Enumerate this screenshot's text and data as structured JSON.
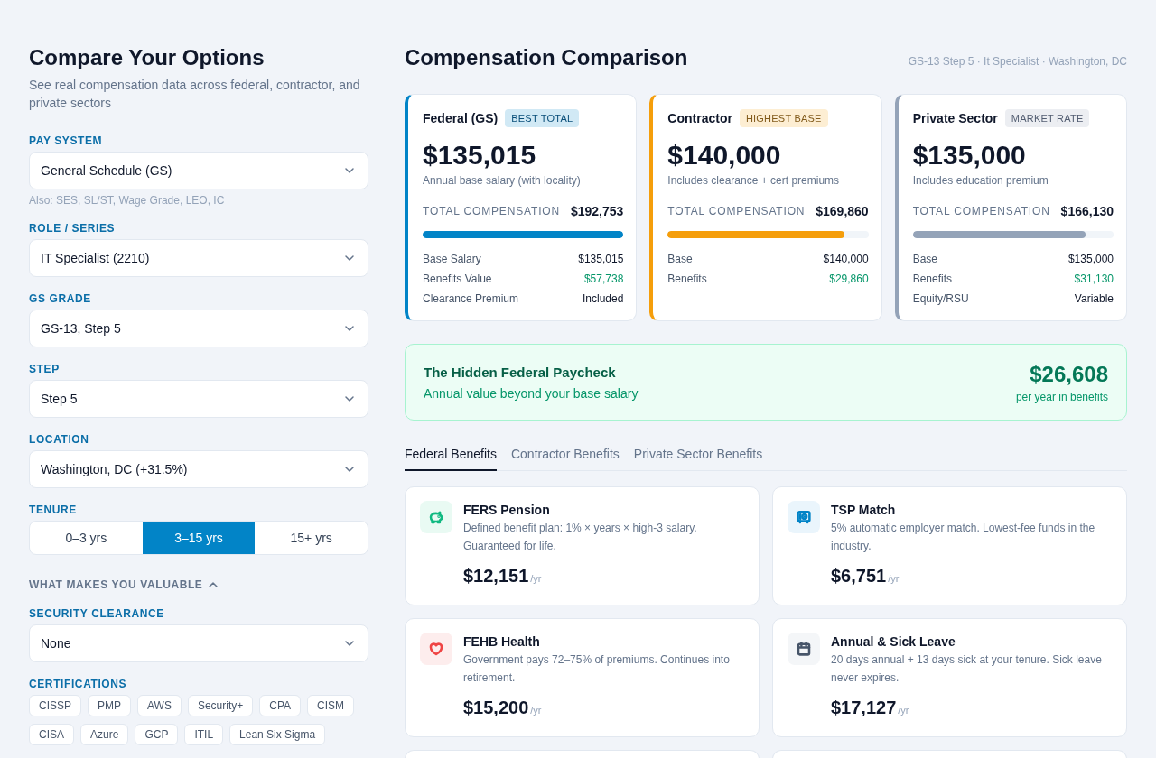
{
  "sidebar": {
    "title": "Compare Your Options",
    "subtitle": "See real compensation data across federal, contractor, and private sectors",
    "fields": [
      {
        "label": "PAY SYSTEM",
        "value": "General Schedule (GS)",
        "hint": "Also: SES, SL/ST, Wage Grade, LEO, IC"
      },
      {
        "label": "ROLE / SERIES",
        "value": "IT Specialist (2210)"
      },
      {
        "label": "GS GRADE",
        "value": "GS-13, Step 5"
      },
      {
        "label": "STEP",
        "value": "Step 5"
      },
      {
        "label": "LOCATION",
        "value": "Washington, DC (+31.5%)"
      }
    ],
    "tenure": {
      "label": "TENURE",
      "options": [
        {
          "label": "0–3 yrs",
          "selected": false
        },
        {
          "label": "3–15 yrs",
          "selected": true
        },
        {
          "label": "15+ yrs",
          "selected": false
        }
      ]
    },
    "valuable": {
      "label": "WHAT MAKES YOU VALUABLE",
      "expanded": true,
      "clearance": {
        "label": "SECURITY CLEARANCE",
        "value": "None"
      },
      "certifications": {
        "label": "CERTIFICATIONS",
        "items": [
          {
            "label": "CISSP",
            "selected": false
          },
          {
            "label": "PMP",
            "selected": false
          },
          {
            "label": "AWS",
            "selected": false
          },
          {
            "label": "Security+",
            "selected": false
          },
          {
            "label": "CPA",
            "selected": false
          },
          {
            "label": "CISM",
            "selected": false
          },
          {
            "label": "CISA",
            "selected": false
          },
          {
            "label": "Azure",
            "selected": false
          },
          {
            "label": "GCP",
            "selected": false
          },
          {
            "label": "ITIL",
            "selected": false
          },
          {
            "label": "Lean Six Sigma",
            "selected": false
          }
        ]
      }
    }
  },
  "main": {
    "title": "Compensation Comparison",
    "context": "GS-13 Step 5 · It Specialist · Washington, DC",
    "sectors": [
      {
        "name": "Federal (GS)",
        "tag": "BEST TOTAL",
        "color": "#0284c7",
        "amount": "$135,015",
        "note": "Annual base salary (with locality)",
        "total_label": "TOTAL COMPENSATION",
        "total": "$192,753",
        "level": 1.0,
        "rows": [
          {
            "label": "Base Salary",
            "value": "$135,015",
            "kind": "plain"
          },
          {
            "label": "Benefits Value",
            "value": "$57,738",
            "kind": "benefit"
          },
          {
            "label": "Clearance Premium",
            "value": "Included",
            "kind": "plain"
          }
        ]
      },
      {
        "name": "Contractor",
        "tag": "HIGHEST BASE",
        "color": "#f59e0b",
        "amount": "$140,000",
        "note": "Includes clearance + cert premiums",
        "total_label": "TOTAL COMPENSATION",
        "total": "$169,860",
        "level": 0.88,
        "rows": [
          {
            "label": "Base",
            "value": "$140,000",
            "kind": "plain"
          },
          {
            "label": "Benefits",
            "value": "$29,860",
            "kind": "benefit"
          }
        ]
      },
      {
        "name": "Private Sector",
        "tag": "MARKET RATE",
        "color": "#94a3b8",
        "amount": "$135,000",
        "note": "Includes education premium",
        "total_label": "TOTAL COMPENSATION",
        "total": "$166,130",
        "level": 0.86,
        "rows": [
          {
            "label": "Base",
            "value": "$135,000",
            "kind": "plain"
          },
          {
            "label": "Benefits",
            "value": "$31,130",
            "kind": "benefit"
          },
          {
            "label": "Equity/RSU",
            "value": "Variable",
            "kind": "plain"
          }
        ]
      }
    ],
    "hidden_paycheck": {
      "title": "The Hidden Federal Paycheck",
      "subtitle": "Annual value beyond your base salary",
      "amount": "$26,608",
      "note": "per year in benefits"
    },
    "tabs": [
      {
        "label": "Federal Benefits",
        "selected": true
      },
      {
        "label": "Contractor Benefits",
        "selected": false
      },
      {
        "label": "Private Sector Benefits",
        "selected": false
      }
    ],
    "benefits": [
      {
        "kind": "pension",
        "title": "FERS Pension",
        "description": "Defined benefit plan: 1% × years × high-3 salary. Guaranteed for life.",
        "amount": "$12,151",
        "unit": "/yr"
      },
      {
        "kind": "savings",
        "title": "TSP Match",
        "description": "5% automatic employer match. Lowest-fee funds in the industry.",
        "amount": "$6,751",
        "unit": "/yr"
      },
      {
        "kind": "health",
        "title": "FEHB Health",
        "description": "Government pays 72–75% of premiums. Continues into retirement.",
        "amount": "$15,200",
        "unit": "/yr"
      },
      {
        "kind": "leave",
        "title": "Annual & Sick Leave",
        "description": "20 days annual + 13 days sick at your tenure. Sick leave never expires.",
        "amount": "$17,127",
        "unit": "/yr"
      },
      {
        "kind": "blank"
      },
      {
        "kind": "blank"
      }
    ]
  }
}
